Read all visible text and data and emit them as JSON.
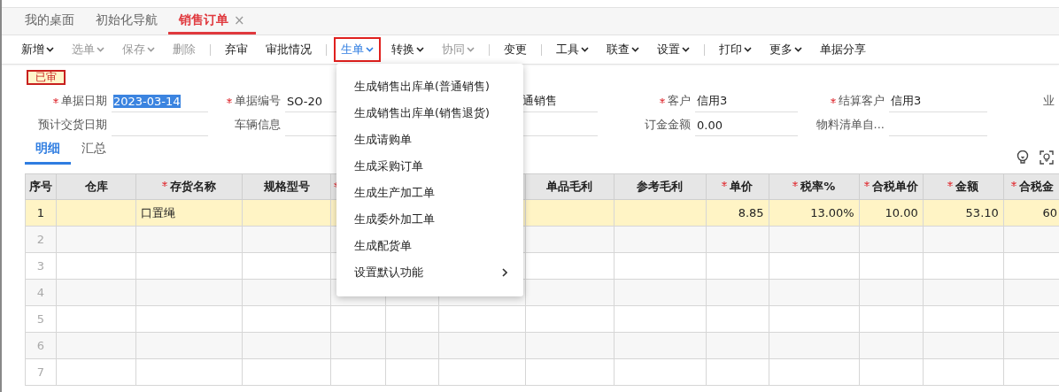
{
  "tabs": [
    {
      "label": "我的桌面",
      "selected": false
    },
    {
      "label": "初始化导航",
      "selected": false
    },
    {
      "label": "销售订单",
      "selected": true,
      "close": "×"
    }
  ],
  "toolbar": [
    [
      {
        "label": "新增",
        "dropdown": true,
        "disabled": false,
        "active": false
      },
      {
        "label": "选单",
        "dropdown": true,
        "disabled": true,
        "active": false
      },
      {
        "label": "保存",
        "dropdown": true,
        "disabled": true,
        "active": false
      },
      {
        "label": "删除",
        "dropdown": false,
        "disabled": true,
        "active": false
      }
    ],
    [
      {
        "label": "弃审",
        "dropdown": false,
        "disabled": false,
        "active": false
      },
      {
        "label": "审批情况",
        "dropdown": false,
        "disabled": false,
        "active": false
      }
    ],
    [
      {
        "label": "生单",
        "dropdown": true,
        "disabled": false,
        "active": true
      },
      {
        "label": "转换",
        "dropdown": true,
        "disabled": false,
        "active": false
      },
      {
        "label": "协同",
        "dropdown": true,
        "disabled": true,
        "active": false
      }
    ],
    [
      {
        "label": "变更",
        "dropdown": false,
        "disabled": false,
        "active": false
      }
    ],
    [
      {
        "label": "工具",
        "dropdown": true,
        "disabled": false,
        "active": false
      },
      {
        "label": "联查",
        "dropdown": true,
        "disabled": false,
        "active": false
      },
      {
        "label": "设置",
        "dropdown": true,
        "disabled": false,
        "active": false
      }
    ],
    [
      {
        "label": "打印",
        "dropdown": true,
        "disabled": false,
        "active": false
      },
      {
        "label": "更多",
        "dropdown": true,
        "disabled": false,
        "active": false
      },
      {
        "label": "单据分享",
        "dropdown": false,
        "disabled": false,
        "active": false
      }
    ]
  ],
  "status_badge": "已审",
  "form": {
    "rows": [
      [
        {
          "label": "单据日期",
          "required": true,
          "value": "2023-03-14",
          "highlighted": true
        },
        {
          "label": "单据编号",
          "required": true,
          "value": "SO-20",
          "highlighted": false
        },
        {
          "value": "通销售",
          "highlighted": false
        },
        {
          "label": "客户",
          "required": true,
          "value": "信用3",
          "highlighted": false
        },
        {
          "label": "结算客户",
          "required": true,
          "value": "信用3",
          "highlighted": false
        },
        {
          "kind": "label",
          "label": "业",
          "required": false
        }
      ],
      [
        {
          "label": "预计交货日期",
          "required": false
        },
        {
          "label": "车辆信息",
          "required": false
        },
        {},
        {
          "label": "订金金额",
          "required": false,
          "value": "0.00",
          "highlighted": false
        },
        {
          "label": "物料清单自...",
          "required": false
        }
      ]
    ]
  },
  "detail_tabs": [
    {
      "label": "明细",
      "selected": true
    },
    {
      "label": "汇总",
      "selected": false
    }
  ],
  "table": {
    "columns": [
      {
        "label": "序号",
        "required": false
      },
      {
        "label": "仓库",
        "required": false
      },
      {
        "label": "存货名称",
        "required": true
      },
      {
        "label": "规格型号",
        "required": false
      },
      {
        "required": true
      },
      {},
      {},
      {
        "label": "单品毛利",
        "required": false
      },
      {
        "label": "参考毛利",
        "required": false
      },
      {
        "label": "单价",
        "required": true,
        "numeric": true
      },
      {
        "label": "税率%",
        "required": true,
        "numeric": true
      },
      {
        "label": "合税单价",
        "required": true,
        "numeric": true
      },
      {
        "label": "金额",
        "required": true,
        "numeric": true
      },
      {
        "label": "合税金",
        "required": true,
        "numeric": true
      }
    ],
    "rows": [
      {
        "no": "1",
        "selected": true,
        "cells": [
          null,
          "口置绳",
          null,
          null,
          null,
          null,
          null,
          null,
          "8.85",
          "13.00%",
          "10.00",
          "53.10",
          "60"
        ]
      },
      {
        "no": "2",
        "selected": false
      },
      {
        "no": "3",
        "selected": false
      },
      {
        "no": "4",
        "selected": false
      },
      {
        "no": "5",
        "selected": false
      },
      {
        "no": "6",
        "selected": false
      },
      {
        "no": "7",
        "selected": false
      }
    ]
  },
  "menu": {
    "items": [
      {
        "label": "生成销售出库单(普通销售)",
        "submenu": false
      },
      {
        "label": "生成销售出库单(销售退货)",
        "submenu": false
      },
      {
        "label": "生成请购单",
        "submenu": false
      },
      {
        "label": "生成采购订单",
        "submenu": false
      },
      {
        "label": "生成生产加工单",
        "submenu": false
      },
      {
        "label": "生成委外加工单",
        "submenu": false
      },
      {
        "label": "生成配货单",
        "submenu": false
      },
      {
        "label": "设置默认功能",
        "submenu": true
      }
    ]
  }
}
